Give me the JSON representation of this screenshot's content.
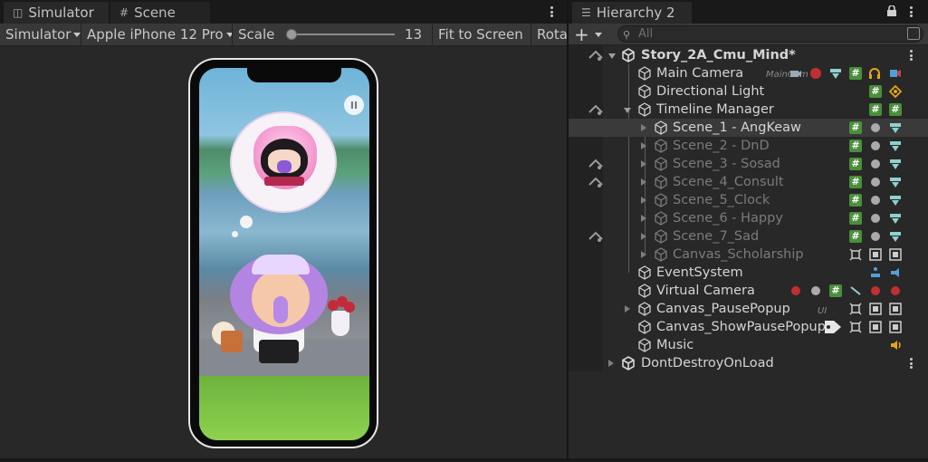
{
  "colors": {
    "selected_row": "#3a3a3a",
    "script_badge": "#4a8f3a",
    "accent_audio": "#e4a614"
  },
  "simulator": {
    "tabs": [
      {
        "label": "Simulator",
        "icon": "simulator-icon"
      },
      {
        "label": "Scene",
        "icon": "grid-icon"
      }
    ],
    "toolbar": {
      "mode": "Simulator",
      "device": "Apple iPhone 12 Pro",
      "scale_label": "Scale",
      "scale_value": "13",
      "fit_to_screen": "Fit to Screen",
      "rotate": "Rota"
    }
  },
  "hierarchy": {
    "tab_label": "Hierarchy 2",
    "search_placeholder": "All",
    "add_label": "+",
    "items": [
      {
        "label": "Story_2A_Cmu_Mind*",
        "type": "scene",
        "expanded": true
      },
      {
        "label": "Main Camera",
        "sub": "MainCam"
      },
      {
        "label": "Directional Light"
      },
      {
        "label": "Timeline Manager",
        "expanded": true
      },
      {
        "label": "Scene_1 - AngKeaw",
        "selected": true
      },
      {
        "label": "Scene_2 - DnD",
        "disabled": true
      },
      {
        "label": "Scene_3 - Sosad",
        "disabled": true
      },
      {
        "label": "Scene_4_Consult",
        "disabled": true
      },
      {
        "label": "Scene_5_Clock",
        "disabled": true
      },
      {
        "label": "Scene_6 - Happy",
        "disabled": true
      },
      {
        "label": "Scene_7_Sad",
        "disabled": true
      },
      {
        "label": "Canvas_Scholarship",
        "disabled": true
      },
      {
        "label": "EventSystem"
      },
      {
        "label": "Virtual Camera"
      },
      {
        "label": "Canvas_PausePopup",
        "sub": "UI"
      },
      {
        "label": "Canvas_ShowPausePopup"
      },
      {
        "label": "Music"
      },
      {
        "label": "DontDestroyOnLoad",
        "type": "scene"
      }
    ]
  }
}
